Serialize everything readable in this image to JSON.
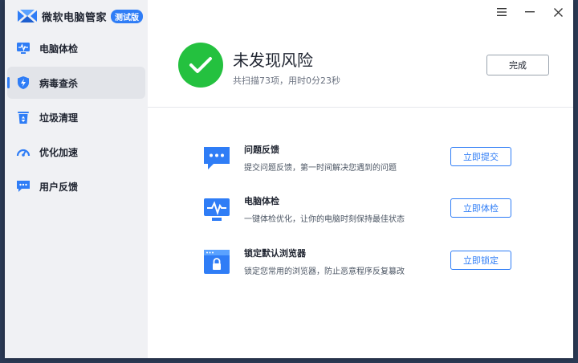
{
  "app": {
    "name": "微软电脑管家",
    "badge": "测试版"
  },
  "sidebar": {
    "items": [
      {
        "label": "电脑体检",
        "icon": "monitor-pulse-icon"
      },
      {
        "label": "病毒查杀",
        "icon": "shield-bolt-icon",
        "active": true
      },
      {
        "label": "垃圾清理",
        "icon": "recycle-bin-icon"
      },
      {
        "label": "优化加速",
        "icon": "speedometer-icon"
      },
      {
        "label": "用户反馈",
        "icon": "chat-bubble-icon"
      }
    ]
  },
  "window_controls": [
    "hamburger-menu-icon",
    "minimize-icon",
    "close-icon"
  ],
  "result": {
    "title": "未发现风险",
    "subtitle": "共扫描73项，用时0分23秒",
    "done_label": "完成",
    "status_color": "#24c13f"
  },
  "features": [
    {
      "title": "问题反馈",
      "desc": "提交问题反馈，第一时间解决您遇到的问题",
      "button": "立即提交",
      "icon": "feedback-chat-icon"
    },
    {
      "title": "电脑体检",
      "desc": "一键体检优化，让你的电脑时刻保持最佳状态",
      "button": "立即体检",
      "icon": "monitor-pulse-icon"
    },
    {
      "title": "锁定默认浏览器",
      "desc": "锁定您常用的浏览器，防止恶意程序反复篡改",
      "button": "立即锁定",
      "icon": "browser-lock-icon"
    }
  ],
  "colors": {
    "accent": "#2f7df6",
    "sidebar_bg": "#f0f1f4"
  }
}
